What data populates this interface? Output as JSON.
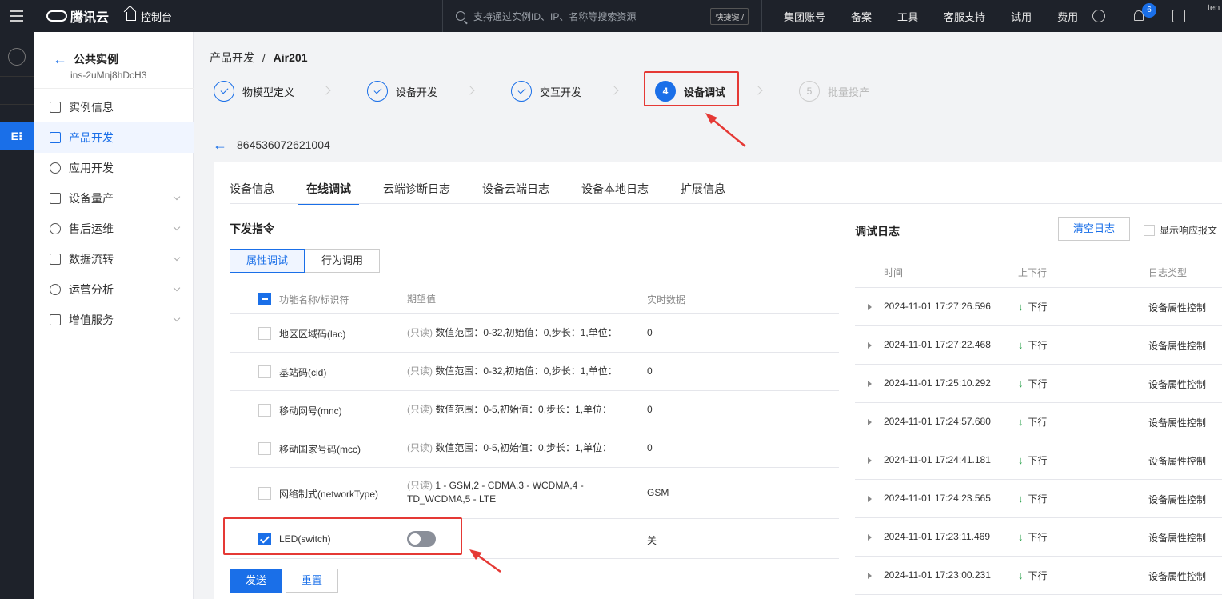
{
  "topbar": {
    "brand": "腾讯云",
    "console": "控制台",
    "search_placeholder": "支持通过实例ID、IP、名称等搜索资源",
    "shortcut": "快捷键 /",
    "links": [
      "集团账号",
      "备案",
      "工具",
      "客服支持",
      "试用",
      "费用"
    ],
    "notification_count": "6",
    "user": "ten"
  },
  "sidebar": {
    "back_label": "公共实例",
    "instance_id": "ins-2uMnj8hDcH3",
    "items": [
      {
        "label": "实例信息",
        "icon": "monitor-icon"
      },
      {
        "label": "产品开发",
        "icon": "chip-icon",
        "active": true
      },
      {
        "label": "应用开发",
        "icon": "gear-icon"
      },
      {
        "label": "设备量产",
        "icon": "list-icon",
        "expandable": true
      },
      {
        "label": "售后运维",
        "icon": "shield-icon",
        "expandable": true
      },
      {
        "label": "数据流转",
        "icon": "flow-icon",
        "expandable": true
      },
      {
        "label": "运营分析",
        "icon": "chart-icon",
        "expandable": true
      },
      {
        "label": "增值服务",
        "icon": "box-icon",
        "expandable": true
      }
    ]
  },
  "breadcrumb": {
    "parent": "产品开发",
    "sep": "/",
    "current": "Air201"
  },
  "steps": [
    {
      "label": "物模型定义",
      "state": "done"
    },
    {
      "label": "设备开发",
      "state": "done"
    },
    {
      "label": "交互开发",
      "state": "done"
    },
    {
      "label": "设备调试",
      "num": "4",
      "state": "current"
    },
    {
      "label": "批量投产",
      "num": "5",
      "state": "pending"
    }
  ],
  "device_id": "864536072621004",
  "tabs": [
    "设备信息",
    "在线调试",
    "云端诊断日志",
    "设备云端日志",
    "设备本地日志",
    "扩展信息"
  ],
  "command": {
    "title": "下发指令",
    "modes": [
      "属性调试",
      "行为调用"
    ],
    "headers": {
      "name": "功能名称/标识符",
      "expected": "期望值",
      "realtime": "实时数据"
    },
    "rows": [
      {
        "name": "地区区域码(lac)",
        "readonly": "(只读)",
        "desc": "数值范围：0-32,初始值：0,步长：1,单位：",
        "value": "0"
      },
      {
        "name": "基站码(cid)",
        "readonly": "(只读)",
        "desc": "数值范围：0-32,初始值：0,步长：1,单位：",
        "value": "0"
      },
      {
        "name": "移动网号(mnc)",
        "readonly": "(只读)",
        "desc": "数值范围：0-5,初始值：0,步长：1,单位：",
        "value": "0"
      },
      {
        "name": "移动国家号码(mcc)",
        "readonly": "(只读)",
        "desc": "数值范围：0-5,初始值：0,步长：1,单位：",
        "value": "0"
      },
      {
        "name": "网络制式(networkType)",
        "readonly": "(只读)",
        "desc": "1 - GSM,2 - CDMA,3 - WCDMA,4 - TD_WCDMA,5 - LTE",
        "value": "GSM"
      },
      {
        "name": "LED(switch)",
        "value": "关"
      }
    ],
    "send_label": "发送",
    "reset_label": "重置"
  },
  "log": {
    "title": "调试日志",
    "clear_label": "清空日志",
    "show_response_label": "显示响应报文",
    "headers": {
      "time": "时间",
      "dir": "上下行",
      "type": "日志类型"
    },
    "rows": [
      {
        "time": "2024-11-01 17:27:26.596",
        "dir": "下行",
        "type": "设备属性控制"
      },
      {
        "time": "2024-11-01 17:27:22.468",
        "dir": "下行",
        "type": "设备属性控制"
      },
      {
        "time": "2024-11-01 17:25:10.292",
        "dir": "下行",
        "type": "设备属性控制"
      },
      {
        "time": "2024-11-01 17:24:57.680",
        "dir": "下行",
        "type": "设备属性控制"
      },
      {
        "time": "2024-11-01 17:24:41.181",
        "dir": "下行",
        "type": "设备属性控制"
      },
      {
        "time": "2024-11-01 17:24:23.565",
        "dir": "下行",
        "type": "设备属性控制"
      },
      {
        "time": "2024-11-01 17:23:11.469",
        "dir": "下行",
        "type": "设备属性控制"
      },
      {
        "time": "2024-11-01 17:23:00.231",
        "dir": "下行",
        "type": "设备属性控制"
      }
    ]
  },
  "colors": {
    "accent": "#1a6fe8",
    "annotation": "#e53935",
    "downlink": "#2ba24c"
  }
}
